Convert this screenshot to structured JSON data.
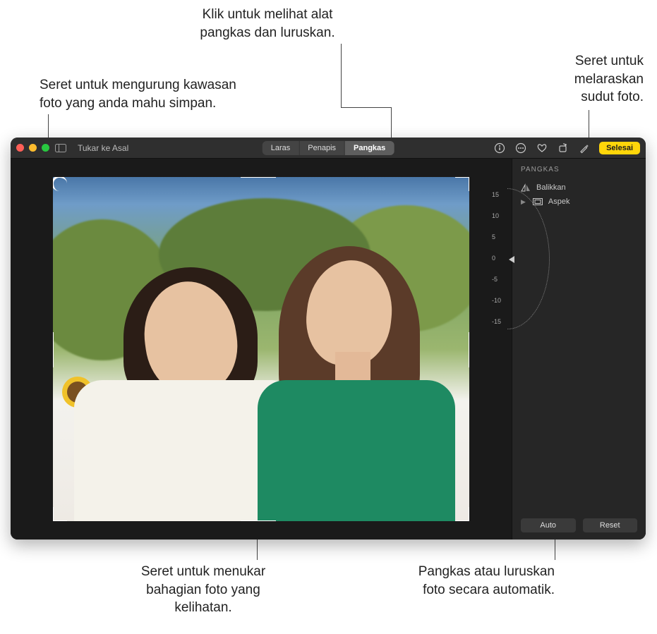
{
  "callouts": {
    "crop_tool": "Klik untuk melihat alat\npangkas dan luruskan.",
    "drag_enclose": "Seret untuk mengurung kawasan\nfoto yang anda mahu simpan.",
    "drag_angle": "Seret untuk\nmelaraskan\nsudut foto.",
    "drag_visible": "Seret untuk menukar\nbahagian foto yang\nkelihatan.",
    "auto_crop": "Pangkas atau luruskan\nfoto secara automatik."
  },
  "toolbar": {
    "revert_label": "Tukar ke Asal",
    "tabs": {
      "adjust": "Laras",
      "filters": "Penapis",
      "crop": "Pangkas"
    },
    "done_label": "Selesai"
  },
  "side_panel": {
    "title": "PANGKAS",
    "flip_label": "Balikkan",
    "aspect_label": "Aspek",
    "auto_label": "Auto",
    "reset_label": "Reset"
  },
  "angle_dial": {
    "ticks": [
      "15",
      "10",
      "5",
      "0",
      "-5",
      "-10",
      "-15"
    ],
    "value": "0"
  }
}
